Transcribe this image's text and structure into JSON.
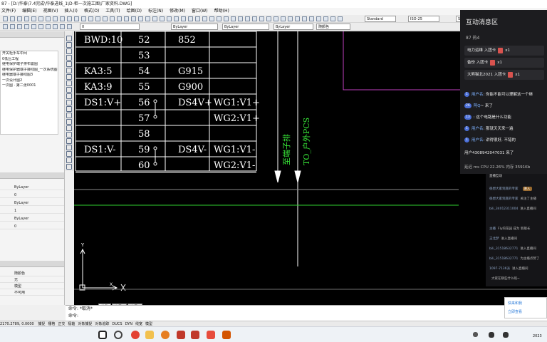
{
  "window": {
    "title": "87 - [D:\\华泰\\7.4完成\\华泰进线_1\\D-柜一次施工图\\厂家资料.DWG]",
    "menu": [
      "文件(F)",
      "编辑(E)",
      "视图(V)",
      "插入(I)",
      "格式(O)",
      "工具(T)",
      "绘图(D)",
      "标注(N)",
      "修改(M)",
      "窗口(W)",
      "帮助(H)"
    ]
  },
  "toolbar": {
    "text_style": "Standard",
    "dim_style": "ISO-25",
    "table_style": "Standard",
    "layer": "0",
    "color": "ByLayer",
    "linetype": "ByLayer",
    "lineweight": "ByLayer",
    "plotstyle": "随颜色"
  },
  "left_panel": {
    "files": [
      "开关柜手车中间",
      "0低压工程",
      "继电保护端子排布置图",
      "继电保护器端子接线图_一次系统图.dwg(1)",
      "继电器端子接线图3",
      "一次设计图2",
      "一次图 · 第二张0001"
    ],
    "properties": [
      {
        "k": "",
        "v": "ByLayer"
      },
      {
        "k": "",
        "v": "0"
      },
      {
        "k": "",
        "v": "ByLayer"
      },
      {
        "k": "",
        "v": "1"
      },
      {
        "k": "",
        "v": "ByLayer"
      },
      {
        "k": "",
        "v": "0"
      }
    ],
    "props2": [
      {
        "k": "",
        "v": "随颜色"
      },
      {
        "k": "",
        "v": "无"
      },
      {
        "k": "",
        "v": "模型"
      },
      {
        "k": "",
        "v": "不可用"
      }
    ]
  },
  "drawing": {
    "rows": [
      {
        "c1": "BWD:10",
        "c2": "52",
        "c3": "852",
        "c4": ""
      },
      {
        "c1": "",
        "c2": "53",
        "c3": "",
        "c4": ""
      },
      {
        "c1": "KA3:5",
        "c2": "54",
        "c3": "G915",
        "c4": ""
      },
      {
        "c1": "KA3:9",
        "c2": "55",
        "c3": "G900",
        "c4": ""
      },
      {
        "c1": "DS1:V+",
        "c2": "56",
        "c3": "DS4V+",
        "c4": "WG1:V1+"
      },
      {
        "c1": "",
        "c2": "57",
        "c3": "",
        "c4": "WG2:V1+"
      },
      {
        "c1": "",
        "c2": "58",
        "c3": "",
        "c4": ""
      },
      {
        "c1": "DS1:V-",
        "c2": "59",
        "c3": "DS4V-",
        "c4": "WG1:V1-"
      },
      {
        "c1": "",
        "c2": "60",
        "c3": "",
        "c4": "WG2:V1-"
      }
    ],
    "vtext1": "至端子排",
    "vtext2": "TO_户外PCS"
  },
  "model_tabs": [
    "模型",
    "布局1",
    "布局2"
  ],
  "command": {
    "line1": "命令: *取消*",
    "line2": "命令:"
  },
  "status": {
    "coords": "2170.2789, 0.0000",
    "toggles": [
      "捕捉",
      "栅格",
      "正交",
      "极轴",
      "对象捕捉",
      "对象追踪",
      "DUCS",
      "DYN",
      "线宽",
      "模型"
    ]
  },
  "message_panel": {
    "title": "互动消息区",
    "stats": "87  热4",
    "gifts": [
      {
        "text": "电力运维 入团卡",
        "count": "x1"
      },
      {
        "text": "备份 入团卡",
        "count": "x1"
      },
      {
        "text": "大熊猫北2021 入团卡",
        "count": "x1"
      }
    ],
    "danmu": [
      {
        "lvl": "1",
        "user": "用户名",
        "text": ": 你能不能可以理解这一个继"
      },
      {
        "lvl": "26",
        "user": "阿Q",
        "text": "~ 来了"
      },
      {
        "lvl": "13",
        "user": "",
        "text": ": 这个电路是什么功能"
      },
      {
        "lvl": "1",
        "user": "用户名",
        "text": ": 那就天天来一遍"
      },
      {
        "lvl": "1",
        "user": "用户名",
        "text": ": 讲得很好, 不错的"
      }
    ],
    "join": "用户4308942047031 来了",
    "footer": "延迟    ms   CPU 22.26%   内存 3591Kb"
  },
  "live_feed": {
    "title": "直播互动",
    "items": [
      {
        "name": "很想大家到底的专家",
        "text": "",
        "badge": "进入"
      },
      {
        "name": "很想大家到底的专家",
        "text": "关注了主播",
        "badge": ""
      },
      {
        "name": "bili_34012311004",
        "text": "进入直播间",
        "badge": ""
      },
      {
        "name": "",
        "text": "",
        "badge": ""
      },
      {
        "name": "主播",
        "text": "Fly的花园 成为 新舰长",
        "badge": ""
      },
      {
        "name": "王北梦",
        "text": "进入直播间",
        "badge": ""
      },
      {
        "name": "bili_31518632771",
        "text": "进入直播间",
        "badge": ""
      },
      {
        "name": "bili_31518632771",
        "text": "为主播点赞了",
        "badge": ""
      },
      {
        "name": "1097-7136派",
        "text": "进入直播间",
        "badge": ""
      },
      {
        "name": "",
        "text": "大家在聊些什么呢~",
        "badge": ""
      }
    ]
  },
  "popup": {
    "line1": "快来和我",
    "line2": "立即查看"
  },
  "taskbar": {
    "time": "2023"
  }
}
